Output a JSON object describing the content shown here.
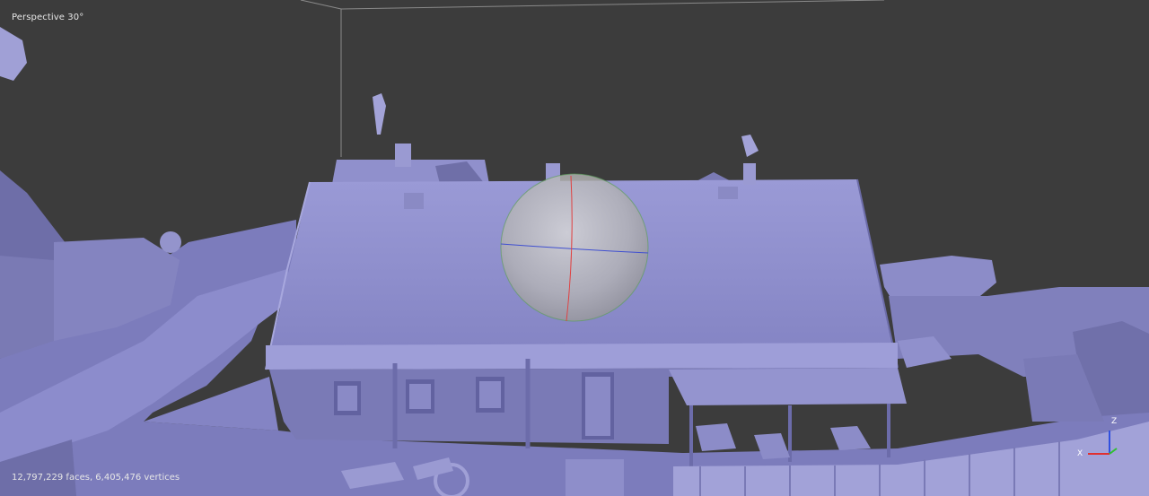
{
  "viewport": {
    "projection_label": "Perspective 30°",
    "stats_label": "12,797,229 faces, 6,405,476 vertices"
  },
  "colors": {
    "background": "#3c3c3c",
    "mesh": "#8888c8",
    "mesh_light": "#a9a9dc",
    "mesh_dark": "#5a5a8e",
    "axis_x": "#e03030",
    "axis_y": "#30c030",
    "axis_z": "#3050e0"
  },
  "icons": {
    "trackball": "rotation-trackball-icon",
    "axis_gizmo": "axis-gizmo-icon"
  }
}
